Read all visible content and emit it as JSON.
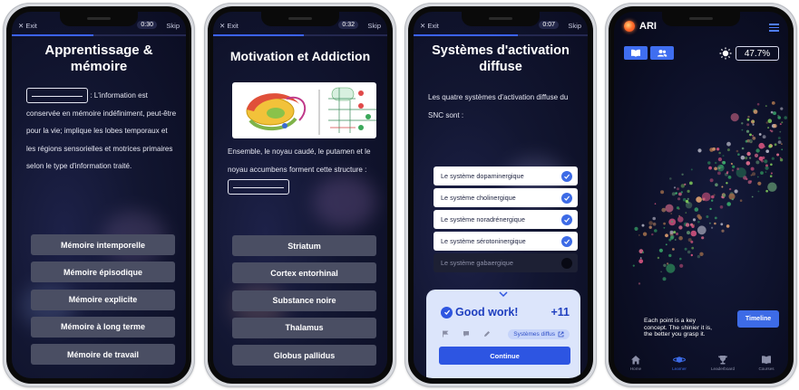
{
  "screen1": {
    "exit": "✕ Exit",
    "timer": "0:30",
    "skip": "Skip",
    "progress": 0.47,
    "title": "Apprentissage & mémoire",
    "question": ": L'information est conservée en mémoire indéfiniment, peut-être pour la vie; implique les lobes temporaux et les régions sensorielles et motrices primaires selon le type d'information traité.",
    "options": [
      "Mémoire intemporelle",
      "Mémoire épisodique",
      "Mémoire explicite",
      "Mémoire à long terme",
      "Mémoire de travail"
    ]
  },
  "screen2": {
    "exit": "✕ Exit",
    "timer": "0:32",
    "skip": "Skip",
    "progress": 0.52,
    "title": "Motivation et Addiction",
    "question": "Ensemble, le noyau caudé, le putamen et le noyau accumbens forment cette structure :",
    "options": [
      "Striatum",
      "Cortex entorhinal",
      "Substance noire",
      "Thalamus",
      "Globus pallidus"
    ]
  },
  "screen3": {
    "exit": "✕ Exit",
    "timer": "0:07",
    "skip": "Skip",
    "progress": 0.6,
    "title": "Systèmes d'activation diffuse",
    "question": "Les quatre systèmes d'activation diffuse du SNC sont :",
    "answers": [
      {
        "label": "Le système dopaminergique",
        "checked": true
      },
      {
        "label": "Le système cholinergique",
        "checked": true
      },
      {
        "label": "Le système noradrénergique",
        "checked": true
      },
      {
        "label": "Le système sérotoninergique",
        "checked": true
      },
      {
        "label": "Le système gabaergique",
        "checked": false
      }
    ],
    "result": {
      "title": "Good work!",
      "points": "+11",
      "chip": "Systèmes diffus",
      "continue": "Continue"
    }
  },
  "screen4": {
    "app_name": "ARI",
    "percent": "47.7%",
    "caption": "Each point is a key concept. The shinier it is, the better you grasp it.",
    "timeline": "Timeline",
    "tabs": [
      {
        "label": "Home",
        "icon": "home-icon",
        "active": false
      },
      {
        "label": "Learner",
        "icon": "learner-icon",
        "active": true
      },
      {
        "label": "Leaderboard",
        "icon": "trophy-icon",
        "active": false
      },
      {
        "label": "Courses",
        "icon": "book-icon",
        "active": false
      }
    ]
  },
  "colors": {
    "accent": "#3d6be6",
    "button": "#4a4e63",
    "background": "#121631",
    "result_panel": "#dce5fb"
  }
}
